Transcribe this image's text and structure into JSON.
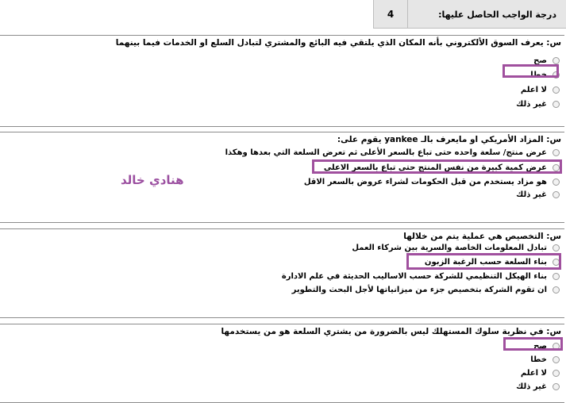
{
  "header": {
    "score_label": "درجة الواجب الحاصل عليها:",
    "score_value": "4"
  },
  "questions": [
    {
      "text": "س: يعرف السوق الألكتروني بأنه المكان الذي يلتقي فيه البائع والمشتري لتبادل السلع او الخدمات فيما بينهما",
      "options": [
        "صح",
        "خطا",
        "لا اعلم",
        "غير ذلك"
      ]
    },
    {
      "text": "س: المزاد الأمريكي او مايعرف بالـ yankee يقوم على:",
      "options": [
        "عرض منتج/ سلعة واحده حتى تباع بالسعر الأعلى ثم تعرض السلعة التي بعدها وهكذا",
        "عرض كمية كبيرة من نفس المنتج حتى تباع بالسعر الاعلى",
        "هو مزاد يستخدم من قبل الحكومات لشراء عروض بالسعر الاقل",
        "غير ذلك"
      ]
    },
    {
      "text": "س: التخصيص هي عملية يتم من خلالها",
      "options": [
        "تبادل المعلومات الخاصة والسرية بين شركاء العمل",
        "بناء السلعة حسب الرغبة الزبون",
        "بناء الهيكل التنظيمي للشركة حسب الاساليب الحديثة في علم الادارة",
        "ان تقوم الشركة بتخصيص جزء من ميزانياتها لأجل البحث والتطوير"
      ]
    },
    {
      "text": "س: في نظرية سلوك المستهلك ليس بالضرورة من يشتري السلعة هو من يستخدمها",
      "options": [
        "صح",
        "خطا",
        "لا اعلم",
        "غير ذلك"
      ]
    }
  ],
  "watermark": "هنادي خالد",
  "colors": {
    "highlight": "#a0509e",
    "header_bg": "#e6e6e6"
  }
}
